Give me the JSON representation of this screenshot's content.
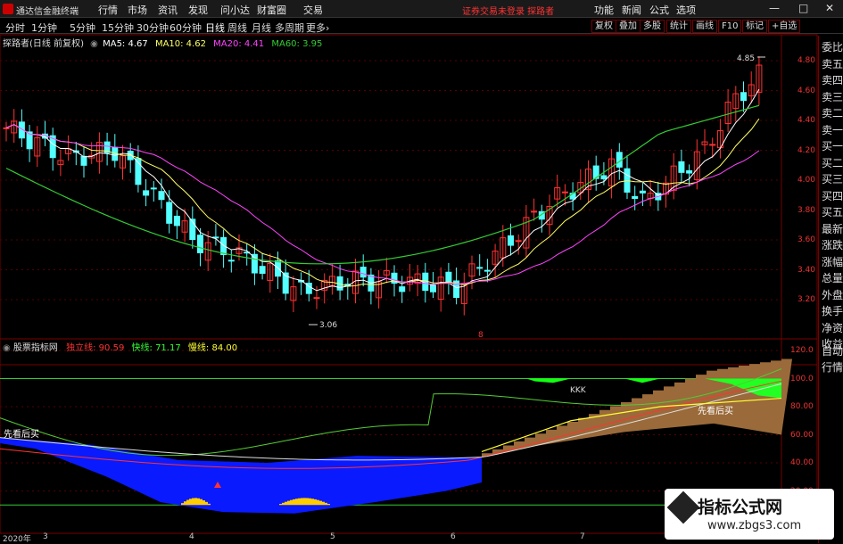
{
  "app": {
    "title": "通达信金融终端",
    "warning": "证券交易未登录  探路者",
    "accent": "#cc0000"
  },
  "menu": [
    "行情",
    "市场",
    "资讯",
    "发现",
    "问小达",
    "财富圈",
    "交易"
  ],
  "right_menu": [
    "功能",
    "新闻",
    "公式",
    "选项"
  ],
  "window_controls": [
    "—",
    "□",
    "✕"
  ],
  "period_tabs": [
    "分时",
    "1分钟",
    "5分钟",
    "15分钟",
    "30分钟",
    "60分钟",
    "日线",
    "周线",
    "月线",
    "多周期",
    "更多›"
  ],
  "active_tab": "日线",
  "tool_buttons": [
    "复权",
    "叠加",
    "多股",
    "统计",
    "画线",
    "F10",
    "标记",
    "+自选"
  ],
  "main_chart": {
    "stock": "探路者(日线 前复权)",
    "ma": [
      {
        "name": "MA5: 4.67",
        "color": "#ffffff"
      },
      {
        "name": "MA10: 4.62",
        "color": "#ffff66"
      },
      {
        "name": "MA20: 4.41",
        "color": "#ff44ff"
      },
      {
        "name": "MA60: 3.95",
        "color": "#33cc33"
      }
    ],
    "high_label": "4.85",
    "low_label": "3.06",
    "marker": "8",
    "axis_ticks": [
      "4.80",
      "4.60",
      "4.40",
      "4.20",
      "4.00",
      "3.80",
      "3.60",
      "3.40",
      "3.20"
    ]
  },
  "sub_chart": {
    "name": "股票指标网",
    "lines": [
      {
        "label": "独立线:",
        "value": "90.59",
        "color": "#ff3333"
      },
      {
        "label": "快线:",
        "value": "71.17",
        "color": "#33ff33"
      },
      {
        "label": "慢线:",
        "value": "84.00",
        "color": "#ffff33"
      }
    ],
    "label_kkk": "KKK",
    "label_left": "先看后买",
    "label_right": "先看后买",
    "axis_ticks": [
      "120.0",
      "100.0",
      "80.00",
      "60.00",
      "40.00",
      "20.00"
    ]
  },
  "sidebar": [
    "委比",
    "卖五",
    "卖四",
    "卖三",
    "卖二",
    "卖一",
    "买一",
    "买二",
    "买三",
    "买四",
    "买五",
    "最新",
    "涨跌",
    "涨幅",
    "总量",
    "外盘",
    "换手",
    "净资",
    "收益"
  ],
  "sidebar2": [
    "自动",
    "行情"
  ],
  "date_axis": [
    "2020年",
    "3",
    "4",
    "5",
    "6",
    "7"
  ],
  "watermark": {
    "line1": "指标公式网",
    "line2": "www.zbgs3.com"
  },
  "chart_data": {
    "type": "candlestick",
    "title": "探路者(日线 前复权)",
    "ylim": [
      3.06,
      4.85
    ],
    "x": [
      "2020-03",
      "2020-04",
      "2020-05",
      "2020-06",
      "2020-07"
    ],
    "annotated_high": 4.85,
    "annotated_low": 3.06,
    "ma_last": {
      "MA5": 4.67,
      "MA10": 4.62,
      "MA20": 4.41,
      "MA60": 3.95
    }
  }
}
